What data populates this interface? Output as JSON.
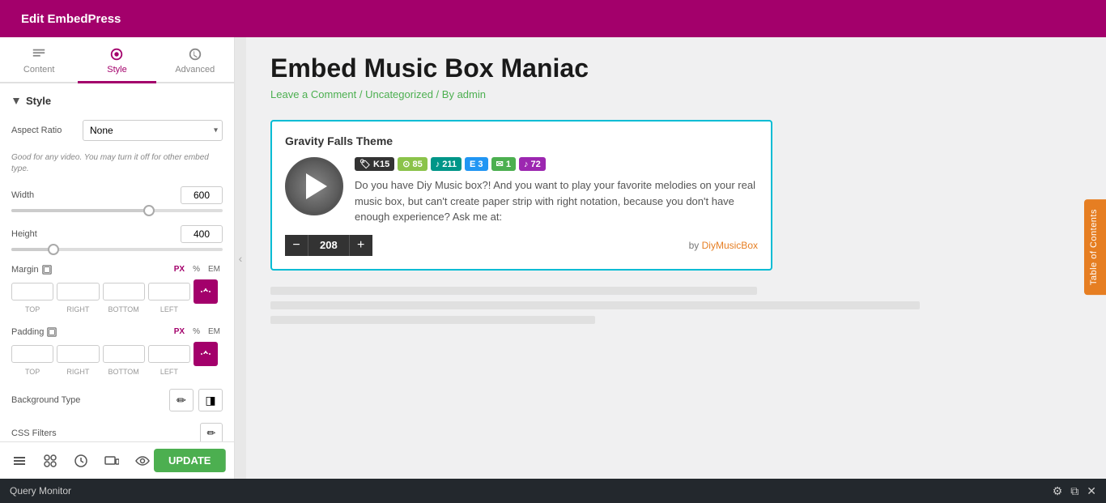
{
  "topbar": {
    "title": "Edit EmbedPress",
    "hamburger_label": "menu",
    "grid_label": "grid"
  },
  "sidebar": {
    "tabs": [
      {
        "label": "Content",
        "id": "content"
      },
      {
        "label": "Style",
        "id": "style",
        "active": true
      },
      {
        "label": "Advanced",
        "id": "advanced"
      }
    ],
    "style_section": {
      "title": "Style",
      "aspect_ratio": {
        "label": "Aspect Ratio",
        "value": "None",
        "hint": "Good for any video. You may turn it off for other embed type."
      },
      "width": {
        "label": "Width",
        "value": "600",
        "slider_pct": 65
      },
      "height": {
        "label": "Height",
        "value": "400",
        "slider_pct": 20
      },
      "margin": {
        "label": "Margin",
        "top": "",
        "right": "",
        "bottom": "",
        "left": "",
        "unit": "PX",
        "units": [
          "PX",
          "%",
          "EM"
        ]
      },
      "padding": {
        "label": "Padding",
        "top": "",
        "right": "",
        "bottom": "",
        "left": "",
        "unit": "PX",
        "units": [
          "PX",
          "%",
          "EM"
        ]
      },
      "bg_type": {
        "label": "Background Type"
      },
      "css_filters": {
        "label": "CSS Filters"
      }
    },
    "bottom": {
      "update_label": "UPDATE"
    }
  },
  "toc": {
    "label": "Table of Contents"
  },
  "page": {
    "title": "Embed Music Box Maniac",
    "meta": "Leave a Comment / Uncategorized / By admin"
  },
  "embed": {
    "title": "Gravity Falls Theme",
    "tags": [
      {
        "label": "K15",
        "class": "tag-dark"
      },
      {
        "label": "85",
        "class": "tag-olive"
      },
      {
        "label": "♪211",
        "class": "tag-teal"
      },
      {
        "label": "E3",
        "class": "tag-blue"
      },
      {
        "label": "1",
        "class": "tag-green"
      },
      {
        "label": "♪72",
        "class": "tag-purple"
      }
    ],
    "description": "Do you have Diy Music box?! And you want to play your favorite melodies on your real music box, but can't create paper strip with right notation, because you don't have enough experience? Ask me at:",
    "counter": "208",
    "by_label": "by",
    "by_author": "DiyMusicBox"
  },
  "query_monitor": {
    "label": "Query Monitor"
  }
}
